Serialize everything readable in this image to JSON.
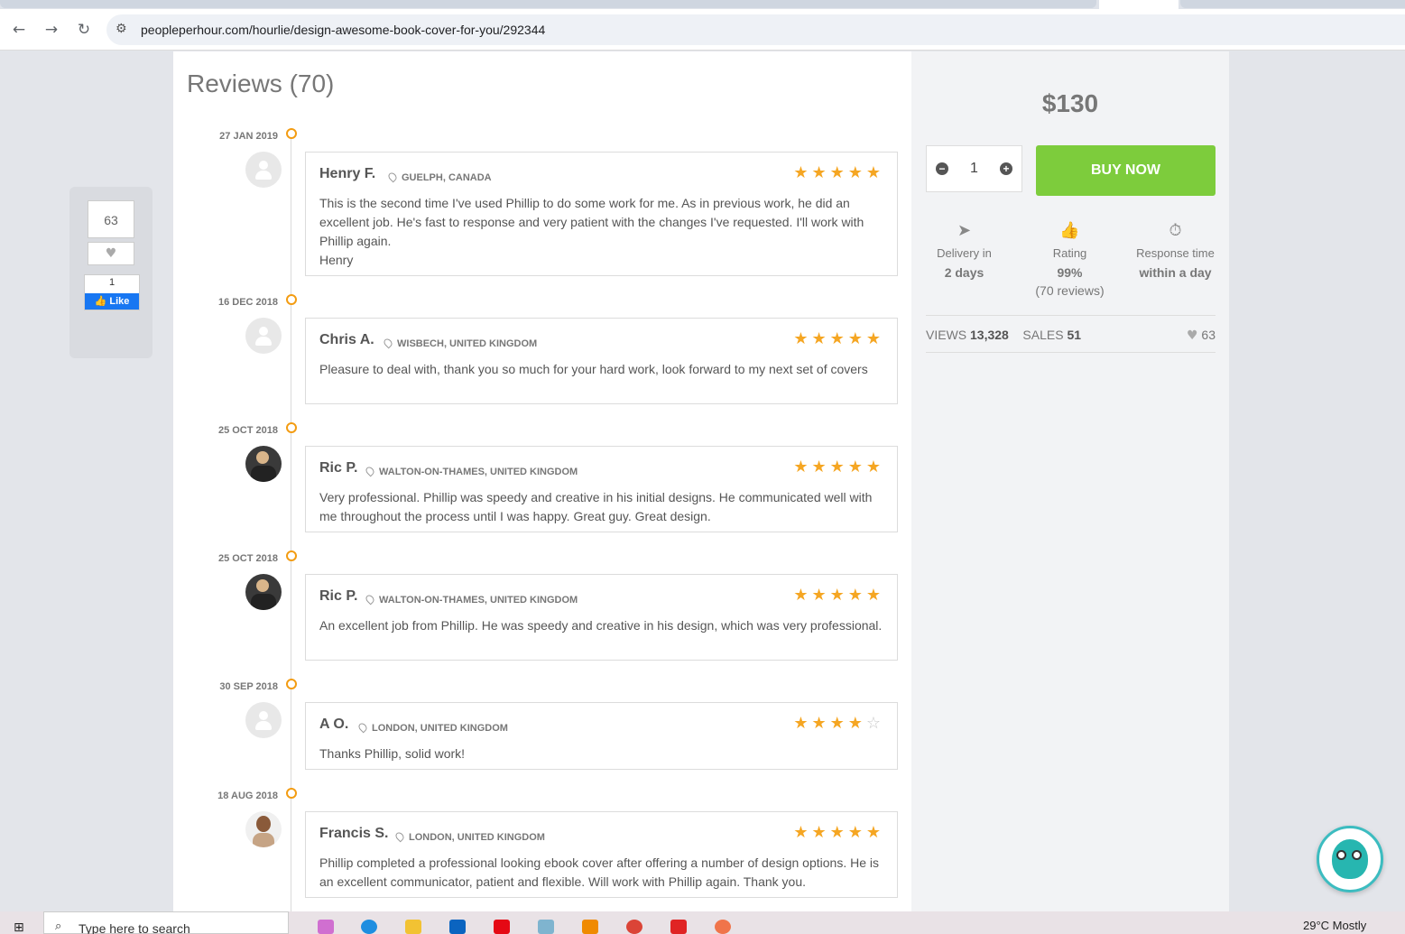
{
  "browser": {
    "url": "peopleperhour.com/hourlie/design-awesome-book-cover-for-you/292344"
  },
  "reviews": {
    "title": "Reviews (70)",
    "items": [
      {
        "date": "27 JAN 2019",
        "name": "Henry F.",
        "location": "GUELPH, CANADA",
        "rating": 5,
        "stars": "★★★★★",
        "stars_empty": "",
        "text": "This is the second time I've used Phillip to do some work for me. As in previous work, he did an excellent job. He's fast to response and very patient with the changes I've requested. I'll work with Phillip again.",
        "text2": "Henry"
      },
      {
        "date": "16 DEC 2018",
        "name": "Chris A.",
        "location": "WISBECH, UNITED KINGDOM",
        "rating": 5,
        "stars": "★★★★★",
        "stars_empty": "",
        "text": "Pleasure to deal with, thank you so much for your hard work, look forward to my next set of covers"
      },
      {
        "date": "25 OCT 2018",
        "name": "Ric P.",
        "location": "WALTON-ON-THAMES, UNITED KINGDOM",
        "rating": 5,
        "stars": "★★★★★",
        "stars_empty": "",
        "text": "Very professional. Phillip was speedy and creative in his initial designs. He communicated well with me throughout the process until I was happy. Great guy. Great design."
      },
      {
        "date": "25 OCT 2018",
        "name": "Ric P.",
        "location": "WALTON-ON-THAMES, UNITED KINGDOM",
        "rating": 5,
        "stars": "★★★★★",
        "stars_empty": "",
        "text": "An excellent job from Phillip. He was speedy and creative in his design, which was very professional."
      },
      {
        "date": "30 SEP 2018",
        "name": "A O.",
        "location": "LONDON, UNITED KINGDOM",
        "rating": 4,
        "stars": "★★★★",
        "stars_empty": "☆",
        "text": "Thanks Phillip, solid work!"
      },
      {
        "date": "18 AUG 2018",
        "name": "Francis S.",
        "location": "LONDON, UNITED KINGDOM",
        "rating": 5,
        "stars": "★★★★★",
        "stars_empty": "",
        "text": "Phillip completed a professional looking ebook cover after offering a number of design options. He is an excellent communicator, patient and flexible. Will work with Phillip again. Thank you."
      }
    ]
  },
  "share": {
    "count": "63",
    "fb_count": "1",
    "fb_label": "Like"
  },
  "offer": {
    "price": "$130",
    "quantity": "1",
    "buy_label": "BUY NOW",
    "delivery_label": "Delivery in",
    "delivery_value": "2 days",
    "rating_label": "Rating",
    "rating_value": "99%",
    "rating_sub": "(70 reviews)",
    "response_label": "Response time",
    "response_value": "within a day",
    "views_label": "VIEWS",
    "views_value": "13,328",
    "sales_label": "SALES",
    "sales_value": "51",
    "likes": "63"
  },
  "taskbar": {
    "search_placeholder": "Type here to search",
    "weather": "29°C  Mostly"
  },
  "colors": {
    "accent_orange": "#f39c12",
    "star": "#f5a623",
    "buy_green": "#7dcc3c",
    "fb_blue": "#1877f2"
  }
}
